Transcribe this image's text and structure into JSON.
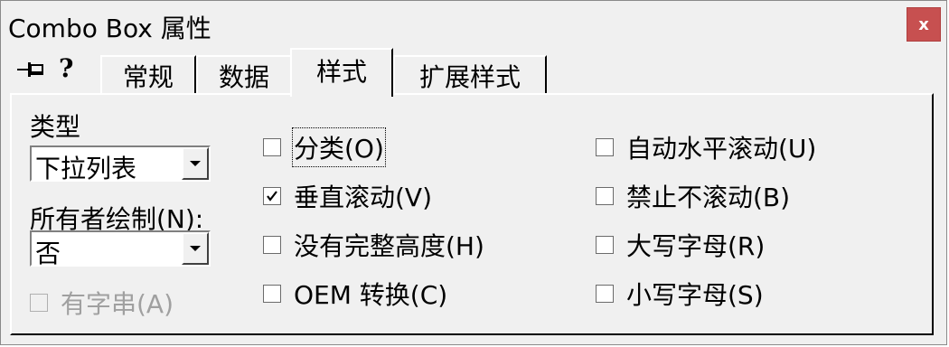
{
  "window": {
    "title": "Combo Box 属性",
    "close_label": "x"
  },
  "toolbar": {
    "pin_icon": "pushpin-icon",
    "help_label": "?"
  },
  "tabs": [
    {
      "label": "常规",
      "active": false
    },
    {
      "label": "数据",
      "active": false
    },
    {
      "label": "样式",
      "active": true
    },
    {
      "label": "扩展样式",
      "active": false
    }
  ],
  "style_tab": {
    "type_label": "类型",
    "type_value": "下拉列表",
    "owner_draw_label": "所有者绘制(N):",
    "owner_draw_value": "否",
    "has_strings": {
      "label": "有字串(A)",
      "checked": false,
      "enabled": false
    },
    "checkboxes_col1": [
      {
        "label": "分类(O)",
        "checked": false
      },
      {
        "label": "垂直滚动(V)",
        "checked": true
      },
      {
        "label": "没有完整高度(H)",
        "checked": false
      },
      {
        "label": "OEM 转换(C)",
        "checked": false
      }
    ],
    "checkboxes_col2": [
      {
        "label": "自动水平滚动(U)",
        "checked": false
      },
      {
        "label": "禁止不滚动(B)",
        "checked": false
      },
      {
        "label": "大写字母(R)",
        "checked": false
      },
      {
        "label": "小写字母(S)",
        "checked": false
      }
    ]
  },
  "colors": {
    "face": "#f0f0f0",
    "close": "#c75050",
    "disabled_text": "#a0a0a0"
  }
}
